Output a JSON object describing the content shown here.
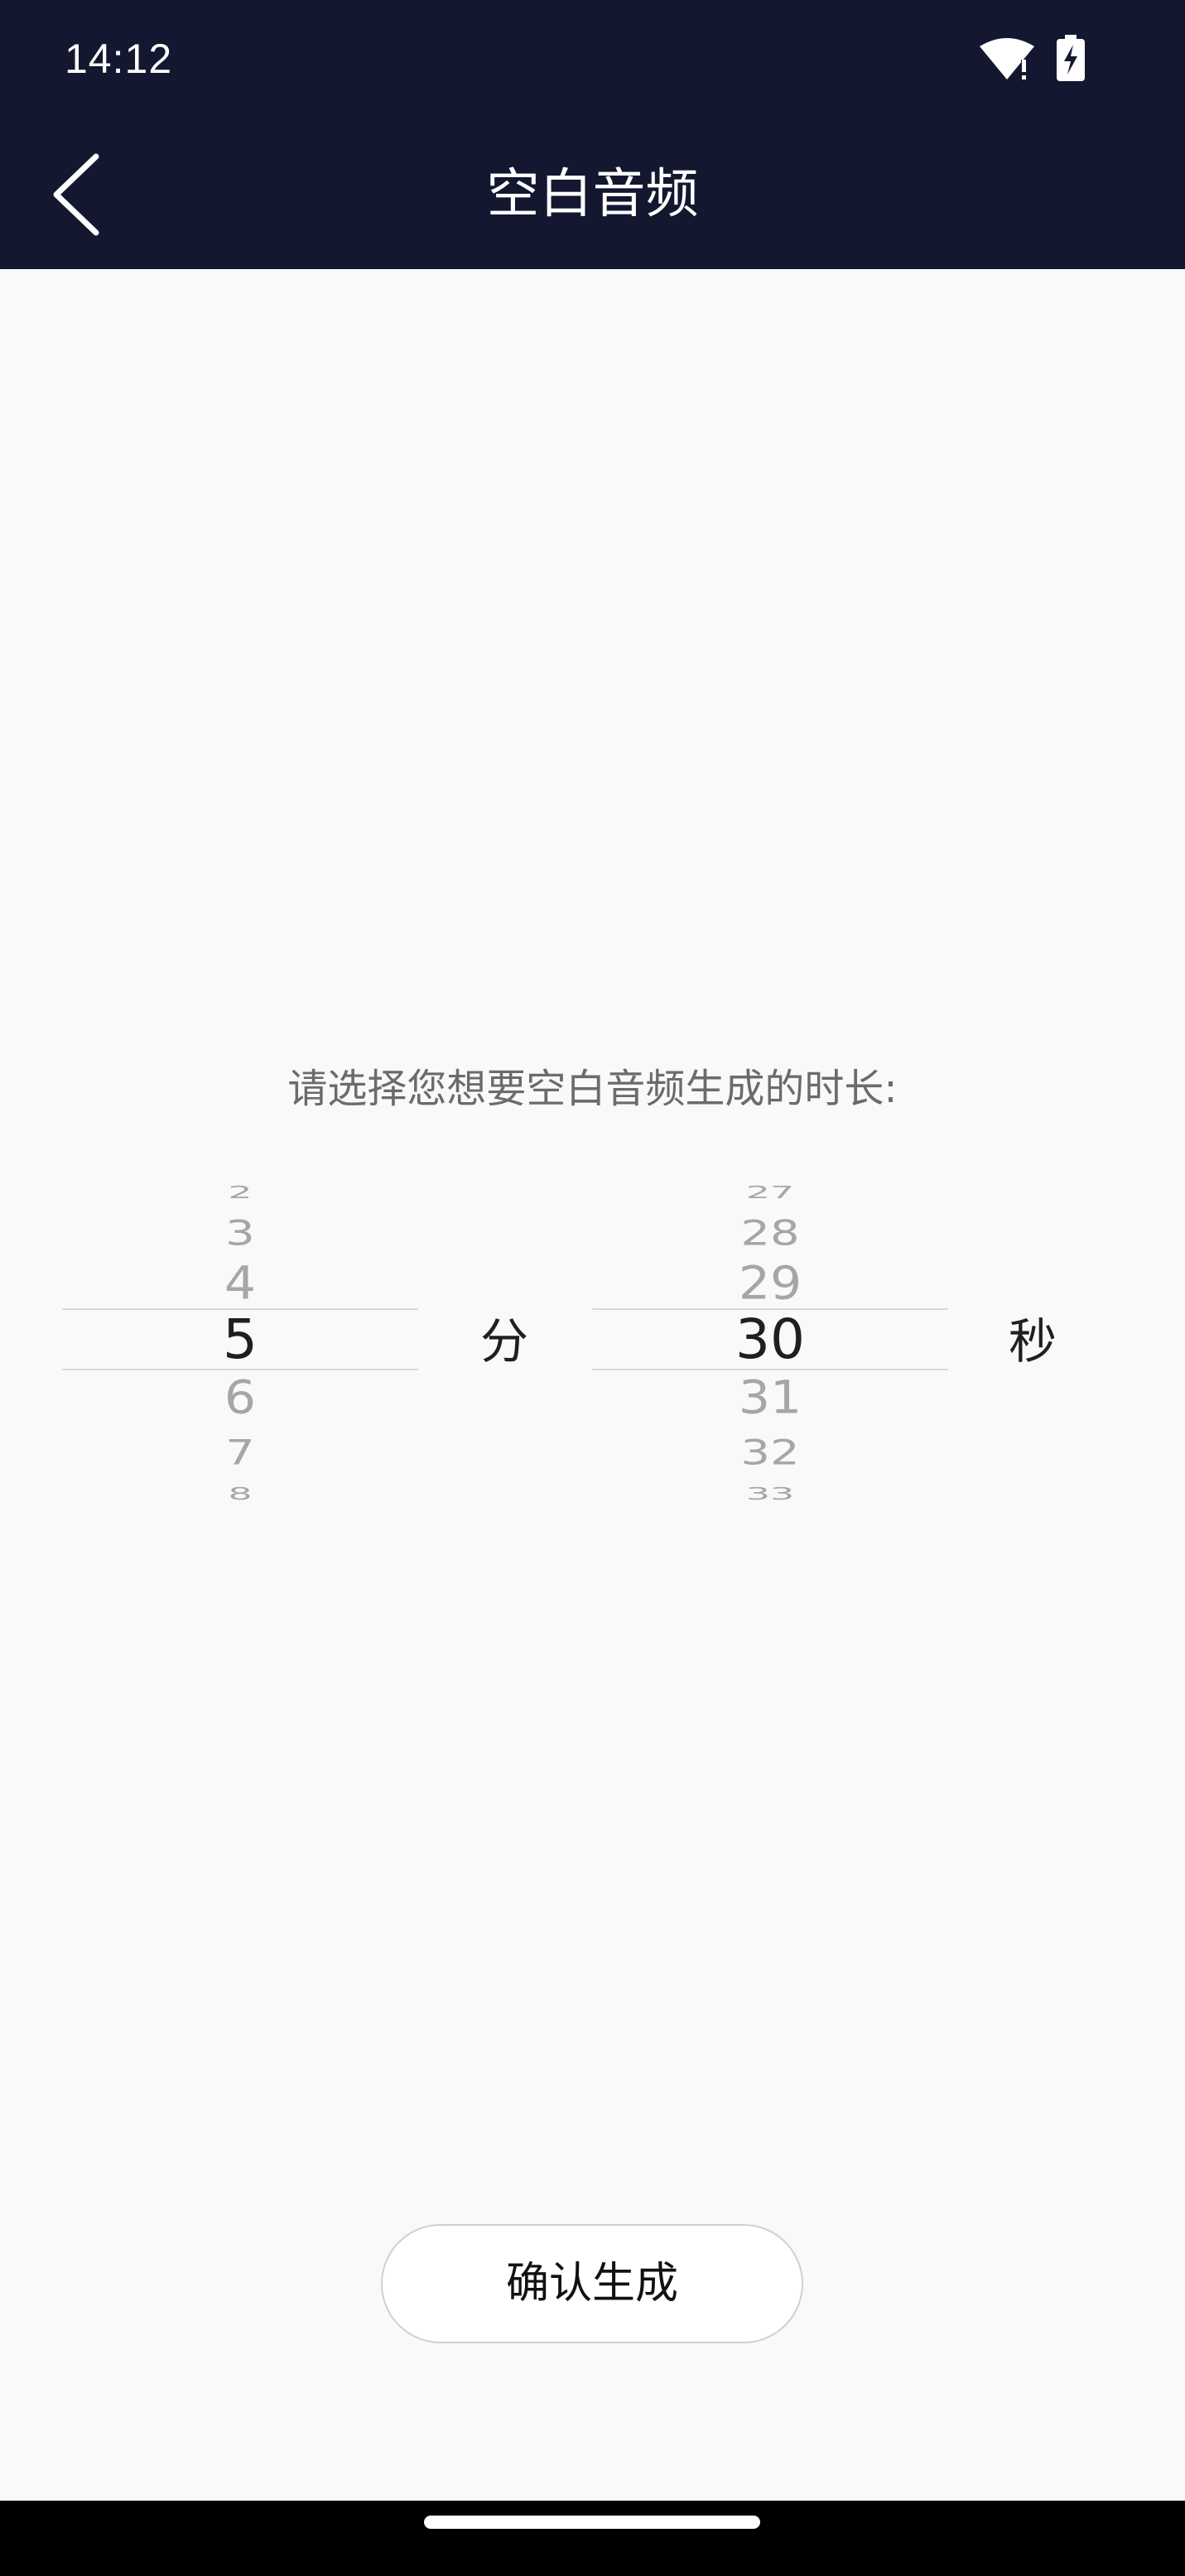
{
  "status_bar": {
    "time": "14:12",
    "icons": [
      "wifi-alert-icon",
      "battery-charging-icon"
    ]
  },
  "app_bar": {
    "title": "空白音频",
    "back_icon": "chevron-left-icon"
  },
  "prompt": "请选择您想要空白音频生成的时长:",
  "minutes_picker": {
    "prev": [
      "2",
      "3",
      "4"
    ],
    "selected": "5",
    "next": [
      "6",
      "7",
      "8"
    ],
    "unit": "分"
  },
  "seconds_picker": {
    "prev": [
      "27",
      "28",
      "29"
    ],
    "selected": "30",
    "next": [
      "31",
      "32",
      "33"
    ],
    "unit": "秒"
  },
  "confirm_button": {
    "label": "确认生成"
  },
  "colors": {
    "header_bg": "#131830",
    "page_bg": "#f9f9f9",
    "muted_text": "#a6a6a6",
    "primary_text": "#1f1f1f"
  }
}
